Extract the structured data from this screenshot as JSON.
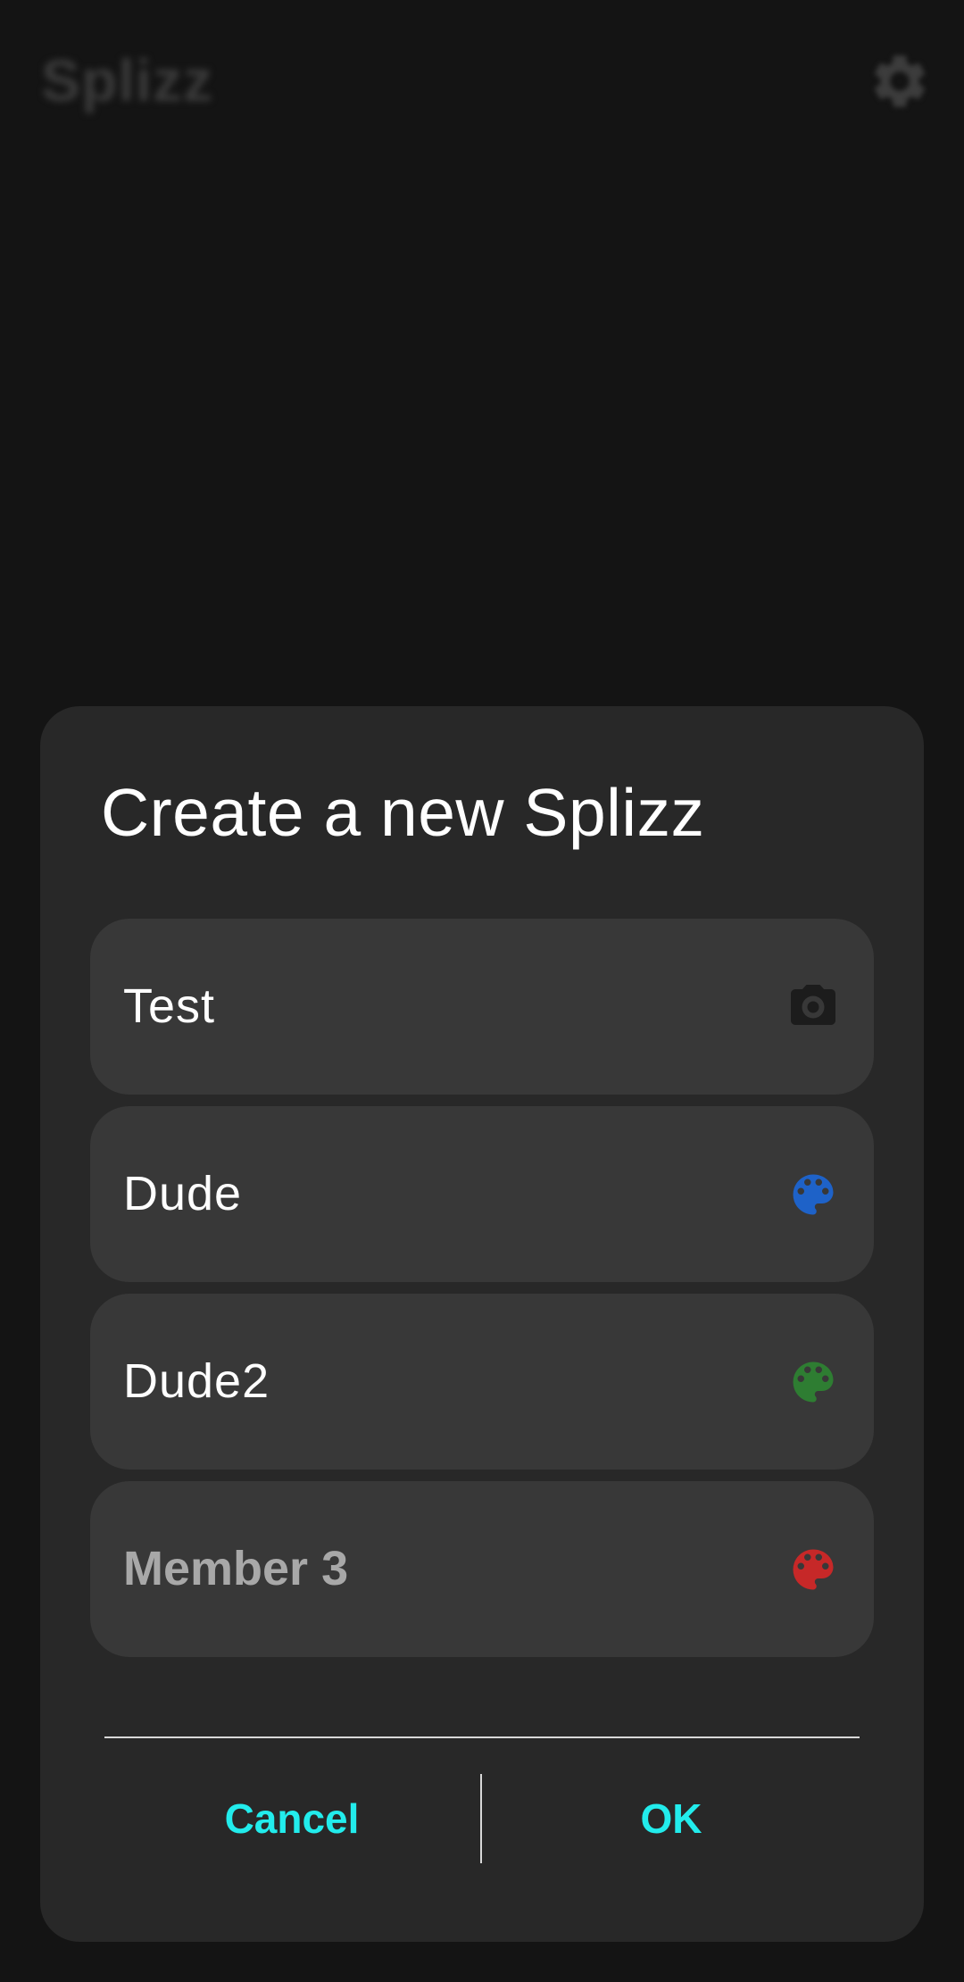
{
  "app_bar": {
    "title": "Splizz",
    "settings_icon": "gear-icon"
  },
  "dialog": {
    "title": "Create a new Splizz",
    "fields": [
      {
        "value": "Test",
        "placeholder": "",
        "icon": "camera-icon",
        "icon_color": "#1c1c1c"
      },
      {
        "value": "Dude",
        "placeholder": "",
        "icon": "palette-icon",
        "icon_color": "#1e62c8"
      },
      {
        "value": "Dude2",
        "placeholder": "",
        "icon": "palette-icon",
        "icon_color": "#2e7d32"
      },
      {
        "value": "",
        "placeholder": "Member 3",
        "icon": "palette-icon",
        "icon_color": "#c62828"
      }
    ],
    "cancel_label": "Cancel",
    "ok_label": "OK"
  },
  "colors": {
    "accent": "#22ecec",
    "background": "#141414",
    "dialog": "#282828",
    "field": "#383838"
  }
}
